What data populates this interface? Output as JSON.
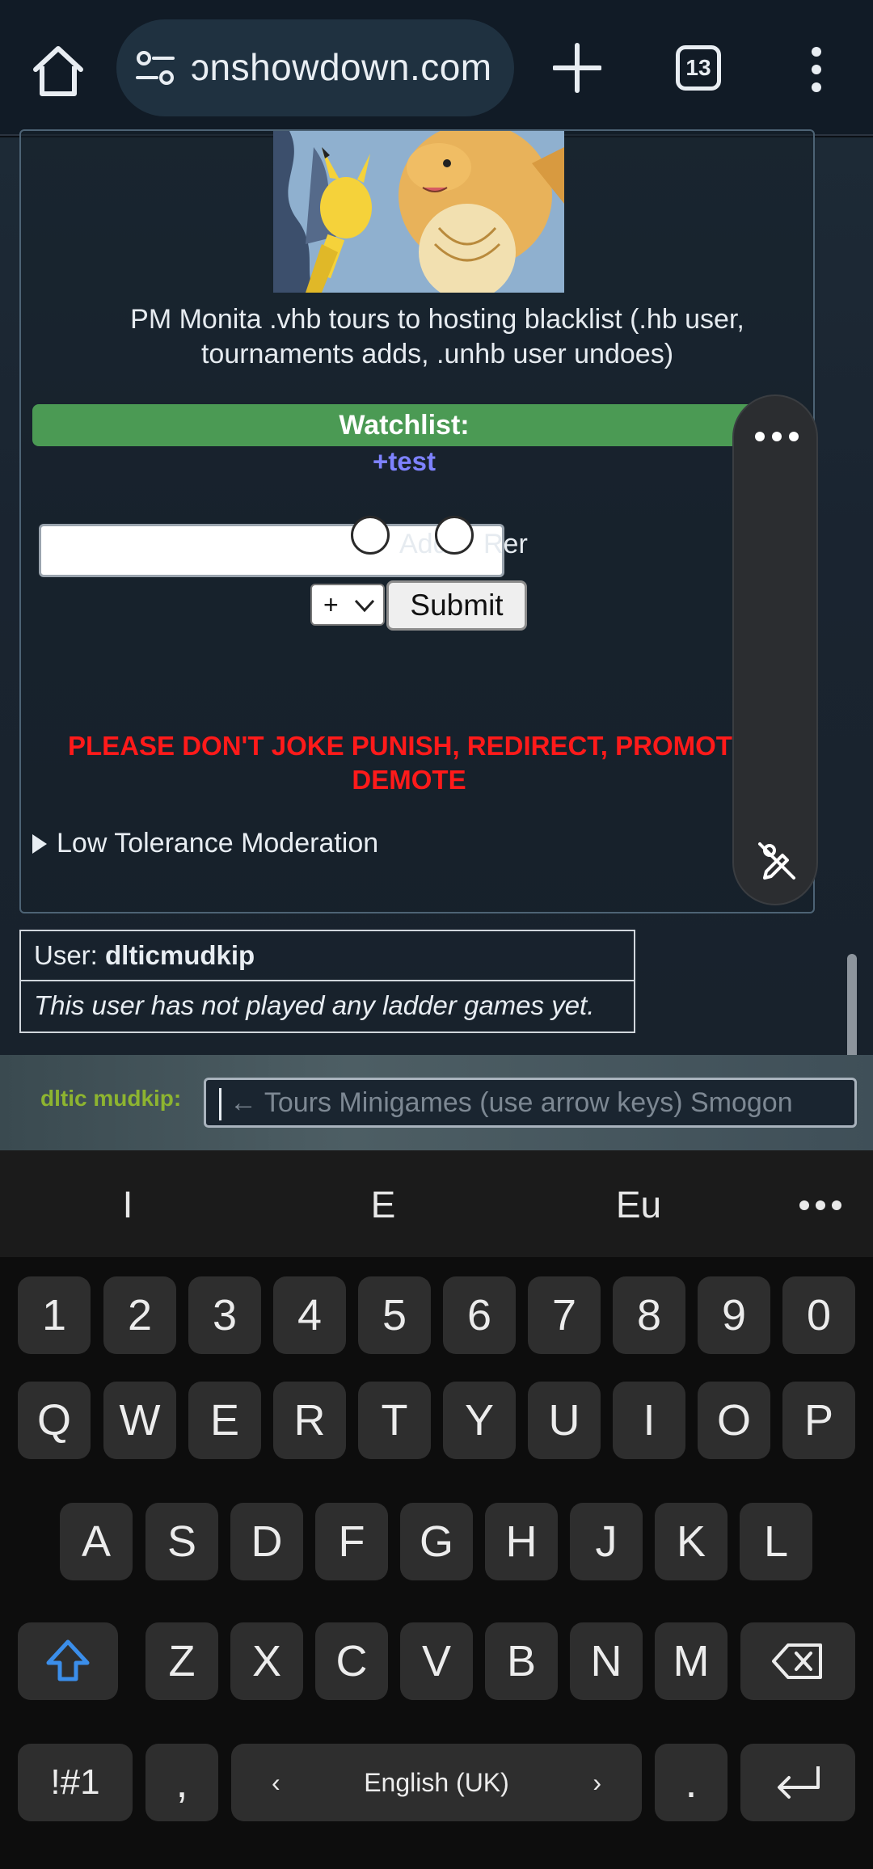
{
  "browser": {
    "url_text": "ɔnshowdown.com",
    "tab_count": "13"
  },
  "page": {
    "caption": "PM Monita .vhb tours to hosting blacklist (.hb user, tournaments adds, .unhb user undoes)",
    "watchlist_title": "Watchlist:",
    "watchlist_item": "+test",
    "user_input_value": "",
    "radio_add_label": "Add",
    "radio_remove_label": "Rer",
    "select_value": "+",
    "submit_label": "Submit",
    "warning_text": "PLEASE DON'T JOKE PUNISH, REDIRECT, PROMOTE DEMOTE",
    "low_tolerance_label": "Low Tolerance Moderation"
  },
  "userbox": {
    "user_label": "User: ",
    "username": "dlticmudkip",
    "ladder_note": "This user has not played any ladder games yet."
  },
  "chat": {
    "name_label": "dltic mudkip:",
    "input_placeholder": "← Tours Minigames (use arrow keys) Smogon"
  },
  "keyboard": {
    "suggestions": [
      "I",
      "E",
      "Eu"
    ],
    "row_numbers": [
      "1",
      "2",
      "3",
      "4",
      "5",
      "6",
      "7",
      "8",
      "9",
      "0"
    ],
    "row1": [
      "Q",
      "W",
      "E",
      "R",
      "T",
      "Y",
      "U",
      "I",
      "O",
      "P"
    ],
    "row2": [
      "A",
      "S",
      "D",
      "F",
      "G",
      "H",
      "J",
      "K",
      "L"
    ],
    "row3": [
      "Z",
      "X",
      "C",
      "V",
      "B",
      "N",
      "M"
    ],
    "symbols_label": "!#1",
    "comma_label": ",",
    "language_label": "English (UK)",
    "period_label": ".",
    "shift_color": "#3b8eea"
  }
}
